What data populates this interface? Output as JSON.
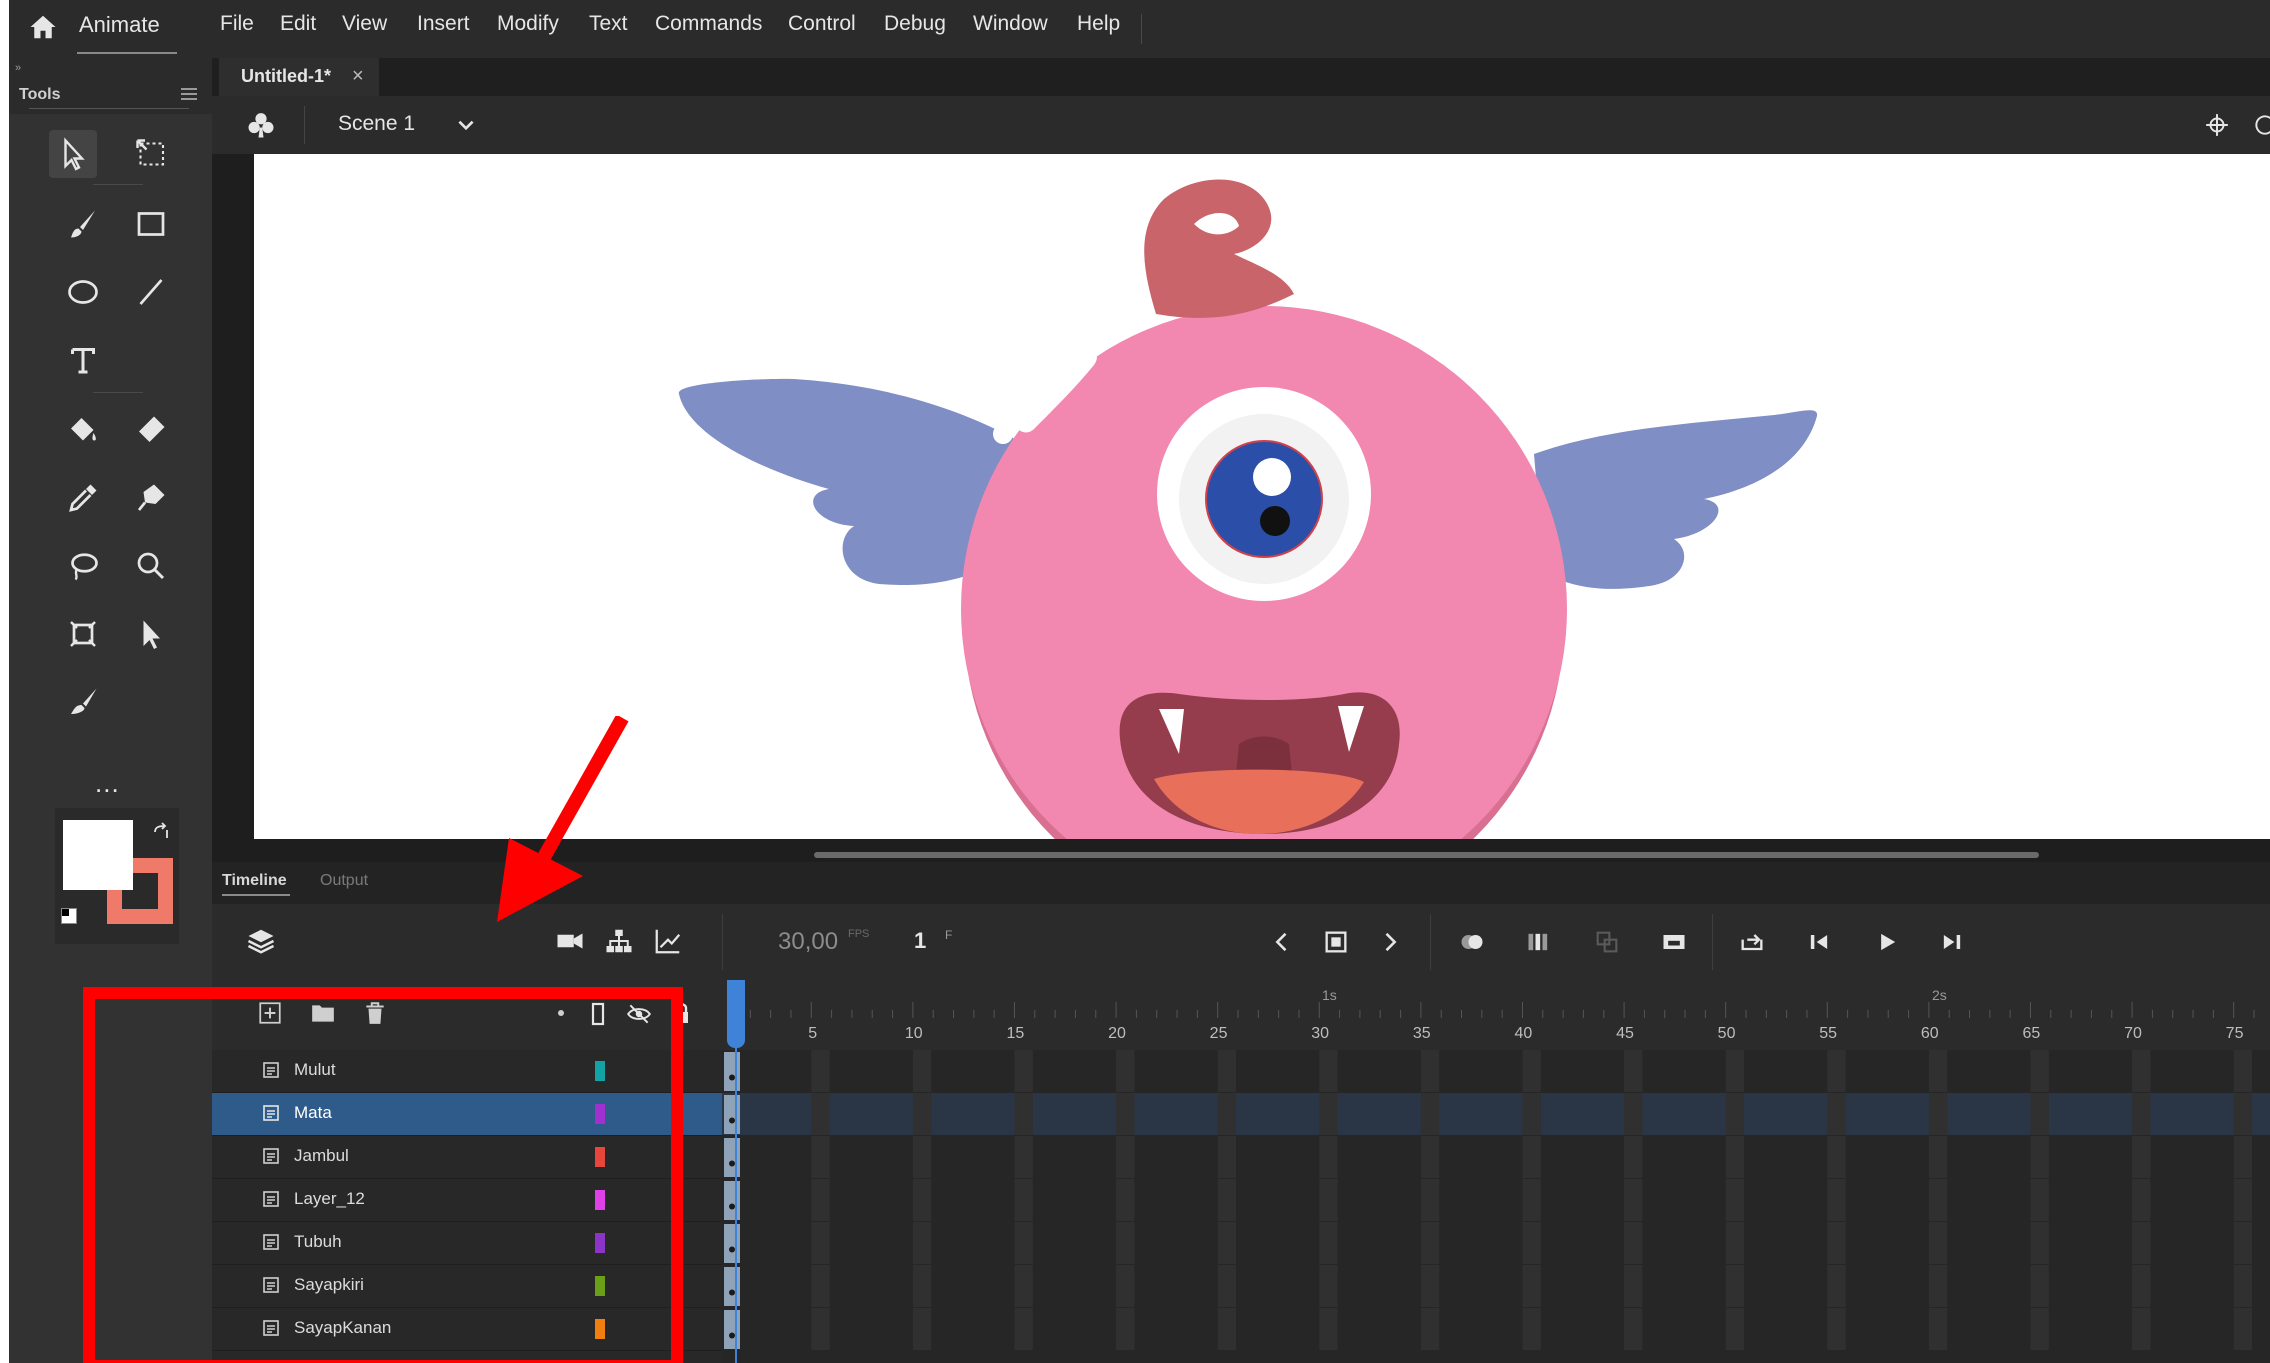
{
  "app": {
    "name": "Animate",
    "menu": [
      "File",
      "Edit",
      "View",
      "Insert",
      "Modify",
      "Text",
      "Commands",
      "Control",
      "Debug",
      "Window",
      "Help"
    ]
  },
  "tools_panel": {
    "title": "Tools",
    "more": "..."
  },
  "document": {
    "tab_title": "Untitled-1*",
    "close": "×"
  },
  "scene": {
    "name": "Scene 1"
  },
  "timeline": {
    "tabs": [
      "Timeline",
      "Output"
    ],
    "fps": "30,00",
    "fps_unit": "FPS",
    "frame": "1",
    "frame_unit": "F",
    "second_markers": [
      "1s",
      "2s"
    ],
    "ticks": [
      "5",
      "10",
      "15",
      "20",
      "25",
      "30",
      "35",
      "40",
      "45",
      "50",
      "55",
      "60",
      "65",
      "70",
      "75"
    ],
    "layers": [
      {
        "name": "Mulut",
        "color": "#12a4a4",
        "selected": false
      },
      {
        "name": "Mata",
        "color": "#a030d0",
        "selected": true
      },
      {
        "name": "Jambul",
        "color": "#e8453c",
        "selected": false
      },
      {
        "name": "Layer_12",
        "color": "#e040e8",
        "selected": false
      },
      {
        "name": "Tubuh",
        "color": "#8a35c8",
        "selected": false
      },
      {
        "name": "Sayapkiri",
        "color": "#6aa018",
        "selected": false
      },
      {
        "name": "SayapKanan",
        "color": "#f07f10",
        "selected": false
      }
    ]
  },
  "colors": {
    "stroke_swatch": "#ffffff",
    "fill_swatch": "#f07a6a",
    "annotation": "#ff0000",
    "selection": "#2f5b8a"
  }
}
